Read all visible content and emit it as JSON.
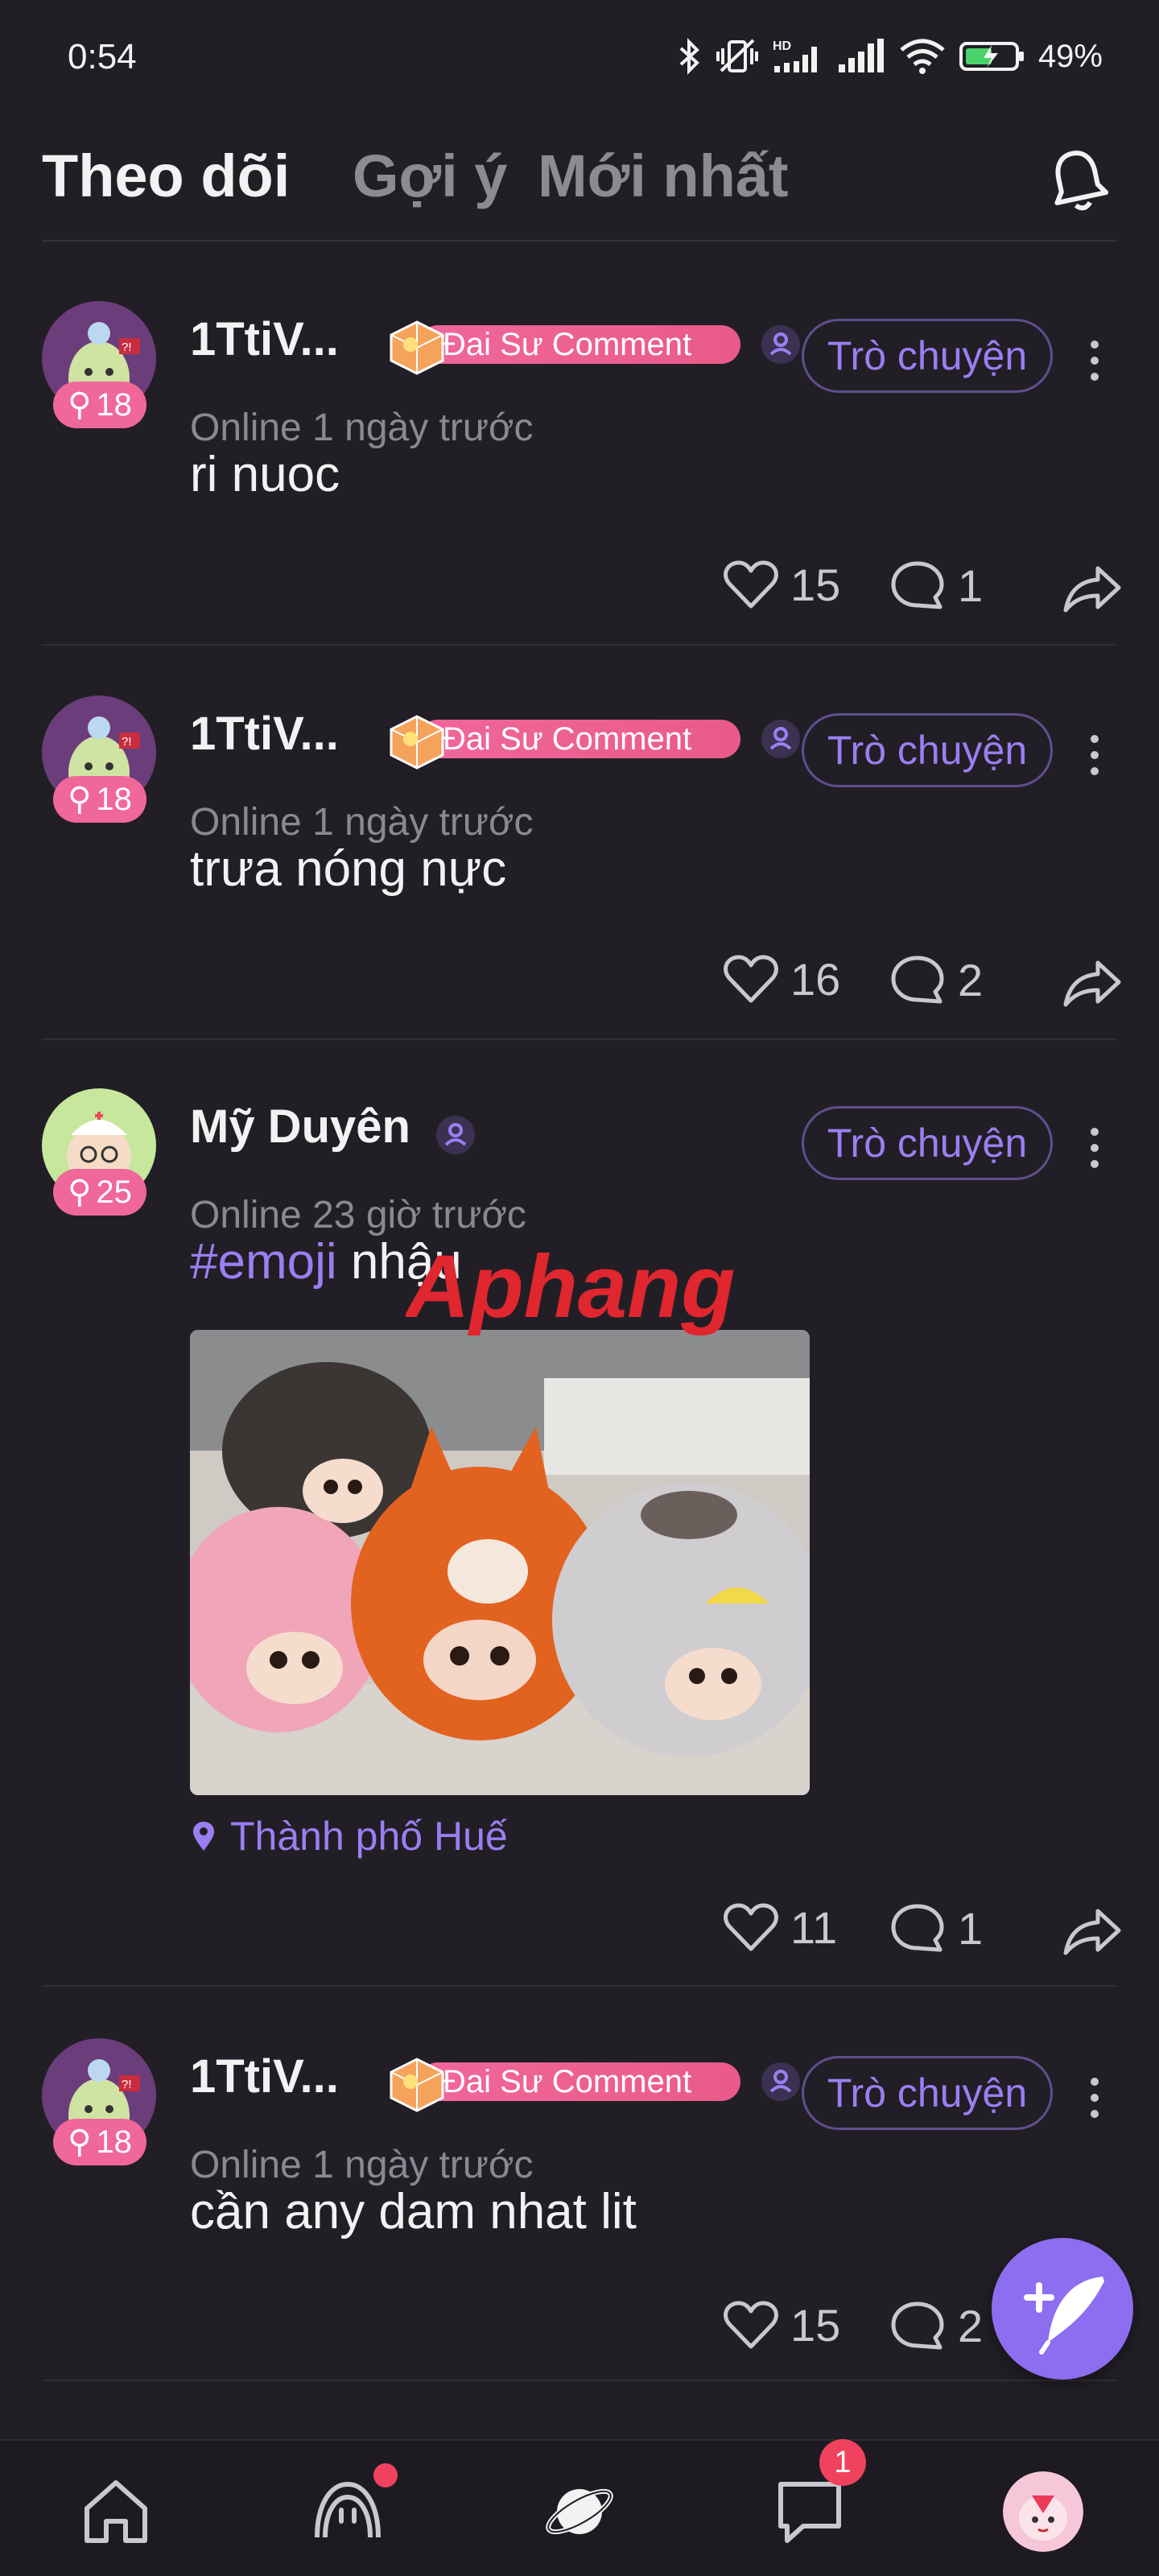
{
  "status_bar": {
    "time": "0:54",
    "battery": "49%",
    "icons": [
      "bluetooth-icon",
      "vibrate-icon",
      "hd-signal-icon",
      "cellular-signal-icon",
      "wifi-icon",
      "battery-charging-icon"
    ]
  },
  "header": {
    "tabs": [
      {
        "label": "Theo dõi",
        "active": true
      },
      {
        "label": "Gợi ý",
        "active": false
      },
      {
        "label": "Mới nhất",
        "active": false
      }
    ],
    "notification_icon": "bell-icon"
  },
  "posts": [
    {
      "username": "1TtiV...",
      "level": "18",
      "badge": "Đai Sư Comment",
      "chat_label": "Trò chuyện",
      "online": "Online 1 ngày trước",
      "content": "ri nuoc",
      "likes": "15",
      "comments": "1"
    },
    {
      "username": "1TtiV...",
      "level": "18",
      "badge": "Đai Sư Comment",
      "chat_label": "Trò chuyện",
      "online": "Online 1 ngày trước",
      "content": "trưa nóng nực",
      "likes": "16",
      "comments": "2"
    },
    {
      "username": "Mỹ Duyên",
      "level": "25",
      "chat_label": "Trò chuyện",
      "online": "Online 23 giờ trước",
      "hashtag": "#emoji",
      "content": " nhậu",
      "location": "Thành phố Huế",
      "likes": "11",
      "comments": "1"
    },
    {
      "username": "1TtiV...",
      "level": "18",
      "badge": "Đai Sư Comment",
      "chat_label": "Trò chuyện",
      "online": "Online 1 ngày trước",
      "content": "cần any dam nhat lit",
      "likes": "15",
      "comments": "2"
    }
  ],
  "watermark": "Aphang",
  "bottom_nav": {
    "items": [
      "home-icon",
      "mascot-icon",
      "planet-icon",
      "messages-icon",
      "profile-avatar"
    ],
    "messages_count": "1"
  },
  "colors": {
    "background": "#211f25",
    "accent": "#9b7ff2",
    "badge_pink": "#f0679a",
    "fab": "#8d6df0"
  }
}
